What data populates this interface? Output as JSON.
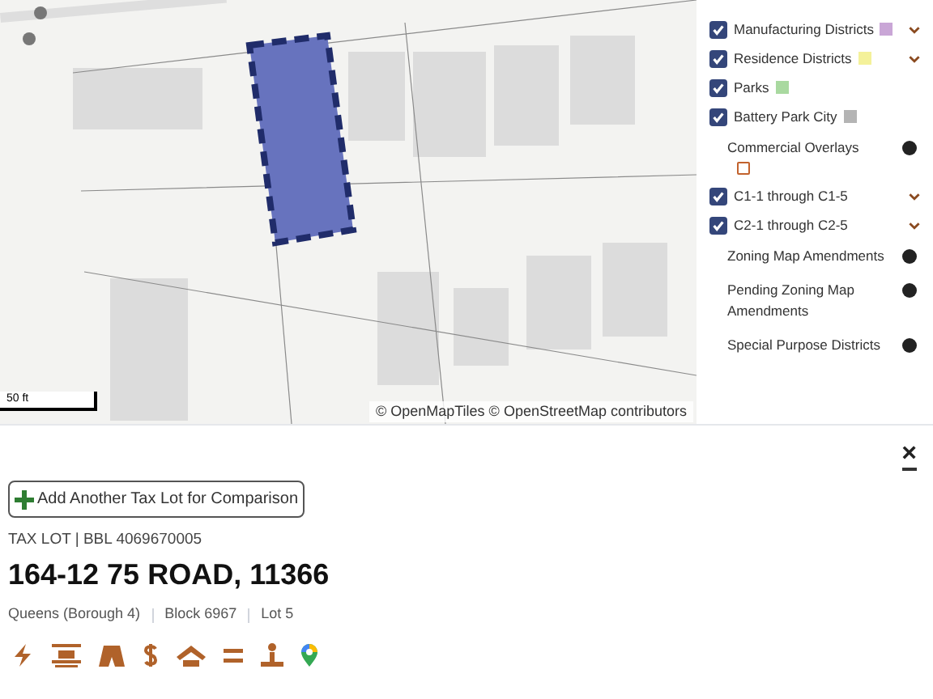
{
  "map": {
    "kind": "picture",
    "scale": "50 ft",
    "attribution": "© OpenMapTiles © OpenStreetMap contributors"
  },
  "layers": [
    {
      "kind": "check",
      "label": "Manufacturing Districts",
      "checked": true,
      "color": "#c9a6d6",
      "chevron": true
    },
    {
      "kind": "check",
      "label": "Residence Districts",
      "checked": true,
      "color": "#f4f19a",
      "chevron": true
    },
    {
      "kind": "check",
      "label": "Parks",
      "checked": true,
      "color": "#a9d9a0",
      "chevron": false
    },
    {
      "kind": "check",
      "label": "Battery Park City",
      "checked": true,
      "color": "#b4b4b4",
      "chevron": false
    },
    {
      "kind": "group",
      "label": "Commercial Overlays",
      "outline": true
    },
    {
      "kind": "check",
      "label": "C1-1 through C1-5",
      "checked": true,
      "chevron": true
    },
    {
      "kind": "check",
      "label": "C2-1 through C2-5",
      "checked": true,
      "chevron": true
    },
    {
      "kind": "group",
      "label": "Zoning Map Amendments"
    },
    {
      "kind": "group",
      "label": "Pending Zoning Map Amendments"
    },
    {
      "kind": "group",
      "label": "Special Purpose Districts"
    }
  ],
  "close": "×",
  "compare_button": "Add Another Tax Lot for Comparison",
  "eyebrow": "TAX LOT | BBL 4069670005",
  "address": "164-12 75 ROAD, 11366",
  "meta": [
    "Queens (Borough 4)",
    "Block 6967",
    "Lot 5"
  ],
  "actions": [
    {
      "kind": "bolt"
    },
    {
      "kind": "layers"
    },
    {
      "kind": "map"
    },
    {
      "kind": "dollar"
    },
    {
      "kind": "house"
    },
    {
      "kind": "equals"
    },
    {
      "kind": "person"
    },
    {
      "kind": "pin"
    }
  ]
}
